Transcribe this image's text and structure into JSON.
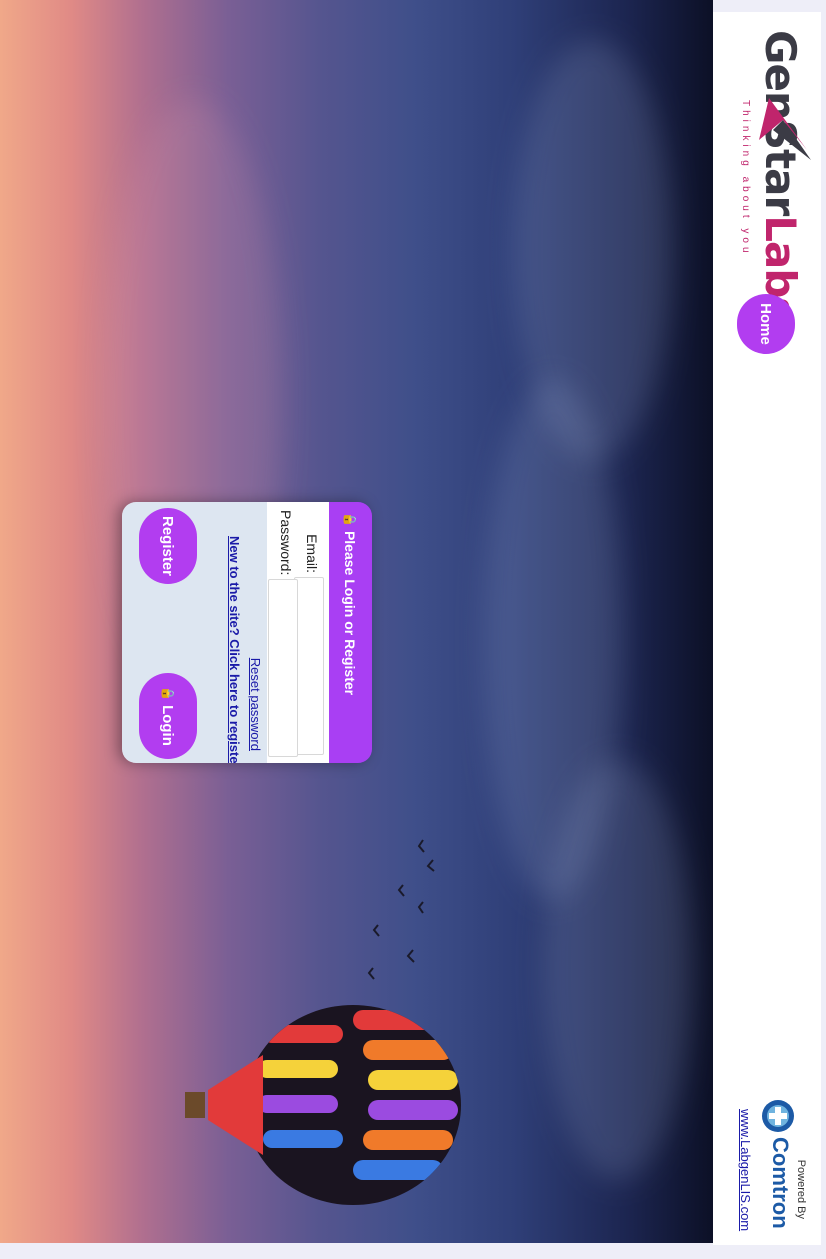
{
  "header": {
    "logo": {
      "name_part1": "GenStar",
      "name_part2": "Labs",
      "tagline": "Thinking about you"
    },
    "home_label": "Home",
    "powered_by": "Powered By",
    "vendor_name": "Comtron",
    "vendor_link": "www.LabgenLIS.com"
  },
  "login": {
    "title": "Please Login or Register",
    "email_label": "Email:",
    "password_label": "Password:",
    "email_value": "",
    "password_value": "",
    "reset_link": "Reset password",
    "register_link": "New to the site? Click here to register",
    "register_button": "Register",
    "login_button": "Login"
  },
  "colors": {
    "accent": "#b23df0",
    "link": "#1a1aa8",
    "brand": "#c0256c"
  }
}
